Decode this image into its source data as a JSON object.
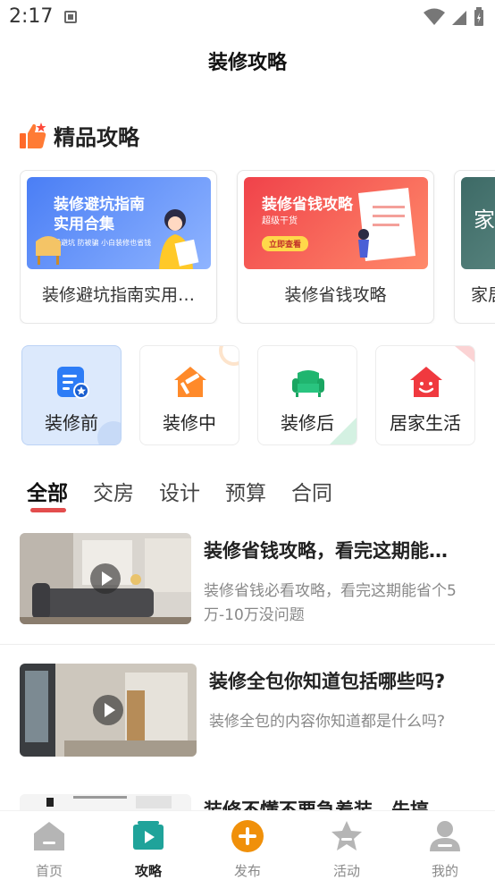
{
  "status_bar": {
    "time": "2:17"
  },
  "header": {
    "title": "装修攻略"
  },
  "featured": {
    "section_title": "精品攻略",
    "cards": [
      {
        "caption": "装修避坑指南实用…",
        "thumb_title": "装修避坑指南\n实用合集",
        "thumb_tags": "看避坑 防被骗 小白装修也省钱"
      },
      {
        "caption": "装修省钱攻略",
        "thumb_title": "装修省钱攻略",
        "thumb_sub": "超级干货",
        "thumb_button": "立即查看"
      },
      {
        "caption": "家居",
        "thumb_title": "家居"
      }
    ]
  },
  "categories": [
    {
      "label": "装修前",
      "icon": "list-doc-icon"
    },
    {
      "label": "装修中",
      "icon": "house-hammer-icon"
    },
    {
      "label": "装修后",
      "icon": "sofa-icon"
    },
    {
      "label": "居家生活",
      "icon": "smile-house-icon"
    }
  ],
  "tabs": [
    "全部",
    "交房",
    "设计",
    "预算",
    "合同"
  ],
  "articles": [
    {
      "title": "装修省钱攻略，看完这期能…",
      "desc": "装修省钱必看攻略，看完这期能省个5万-10万没问题"
    },
    {
      "title": "装修全包你知道包括哪些吗?",
      "desc": "装修全包的内容你知道都是什么吗?"
    },
    {
      "title": "装修不懂不要急着装，先搞…",
      "desc": ""
    }
  ],
  "bottom_nav": [
    {
      "label": "首页",
      "icon": "home-icon"
    },
    {
      "label": "攻略",
      "icon": "guide-play-icon"
    },
    {
      "label": "发布",
      "icon": "plus-circle-icon"
    },
    {
      "label": "活动",
      "icon": "star-icon"
    },
    {
      "label": "我的",
      "icon": "user-icon"
    }
  ],
  "colors": {
    "accent_red": "#e34d4d",
    "active_blue": "#dce9fc",
    "publish_orange": "#f0900a",
    "guide_teal": "#1fa39a"
  }
}
